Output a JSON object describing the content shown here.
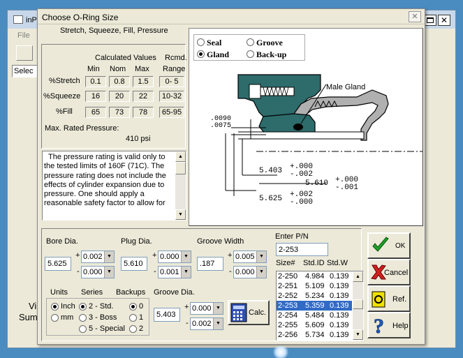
{
  "bg_window": {
    "title": "inP",
    "menu_file": "File",
    "select_label": "Selec",
    "bottom_v": "Vi",
    "bottom_sum": "Sum"
  },
  "dialog": {
    "title": "Choose O-Ring Size",
    "close_glyph": "✕",
    "section_title": "Stretch, Squeeze, Fill, Pressure",
    "calc_header": "Calculated Values",
    "rcmd_header": "Rcmd.",
    "col_min": "Min",
    "col_nom": "Nom",
    "col_max": "Max",
    "col_range": "Range",
    "rows": [
      {
        "label": "%Stretch",
        "min": "0.1",
        "nom": "0.8",
        "max": "1.5",
        "range": "0- 5"
      },
      {
        "label": "%Squeeze",
        "min": "16",
        "nom": "20",
        "max": "22",
        "range": "10-32"
      },
      {
        "label": "%Fill",
        "min": "65",
        "nom": "73",
        "max": "78",
        "range": "65-95"
      }
    ],
    "max_pressure_label": "Max. Rated Pressure:",
    "max_pressure_value": "410 psi",
    "note": "The pressure rating is valid only to the tested limits of 160F (71C). The pressure rating does not include the effects of cylinder expansion due to pressure. One should apply a reasonable safety factor to allow for"
  },
  "diagram": {
    "opt_seal": "Seal",
    "opt_groove": "Groove",
    "opt_gland": "Gland",
    "opt_backup": "Back-up",
    "male_gland_label": "Male Gland",
    "dim_0090": ".0090",
    "dim_0075": ".0075",
    "dim_5403": "5.403",
    "tol_5403_plus": "+.000",
    "tol_5403_minus": "-.002",
    "dim_5610": "5.610",
    "tol_5610_plus": "+.000",
    "tol_5610_minus": "-.001",
    "dim_5625": "5.625",
    "tol_5625_plus": "+.002",
    "tol_5625_minus": "-.000"
  },
  "inputs": {
    "bore_label": "Bore Dia.",
    "bore_value": "5.625",
    "bore_plus": "0.002",
    "bore_minus": "0.000",
    "plug_label": "Plug Dia.",
    "plug_value": "5.610",
    "plug_plus": "0.000",
    "plug_minus": "0.001",
    "groove_width_label": "Groove Width",
    "groove_width_value": ".187",
    "gw_plus": "0.005",
    "gw_minus": "0.000",
    "units_label": "Units",
    "unit_inch": "Inch",
    "unit_mm": "mm",
    "series_label": "Series",
    "series_2": "2 - Std.",
    "series_3": "3 - Boss",
    "series_5": "5 - Special",
    "backups_label": "Backups",
    "backup_0": "0",
    "backup_1": "1",
    "backup_2": "2",
    "groove_dia_label": "Groove Dia.",
    "groove_dia_value": "5.403",
    "gd_plus": "0.000",
    "gd_minus": "0.002",
    "calc_button": "Calc.",
    "plus_sign": "+",
    "minus_sign": "-"
  },
  "partlist": {
    "enter_pn_label": "Enter P/N",
    "pn_value": "2-253",
    "col_size": "Size#",
    "col_stdid": "Std.ID",
    "col_stdw": "Std.W",
    "rows": [
      {
        "size": "2-250",
        "id": "4.984",
        "w": "0.139"
      },
      {
        "size": "2-251",
        "id": "5.109",
        "w": "0.139"
      },
      {
        "size": "2-252",
        "id": "5.234",
        "w": "0.139"
      },
      {
        "size": "2-253",
        "id": "5.359",
        "w": "0.139"
      },
      {
        "size": "2-254",
        "id": "5.484",
        "w": "0.139"
      },
      {
        "size": "2-255",
        "id": "5.609",
        "w": "0.139"
      },
      {
        "size": "2-256",
        "id": "5.734",
        "w": "0.139"
      }
    ],
    "selected_index": 3
  },
  "buttons": {
    "ok": "OK",
    "cancel": "Cancel",
    "ref": "Ref.",
    "help": "Help"
  },
  "colors": {
    "title_bar": "#ece9d8",
    "gland_fill": "#2e6b6b",
    "selection": "#316ac5"
  }
}
